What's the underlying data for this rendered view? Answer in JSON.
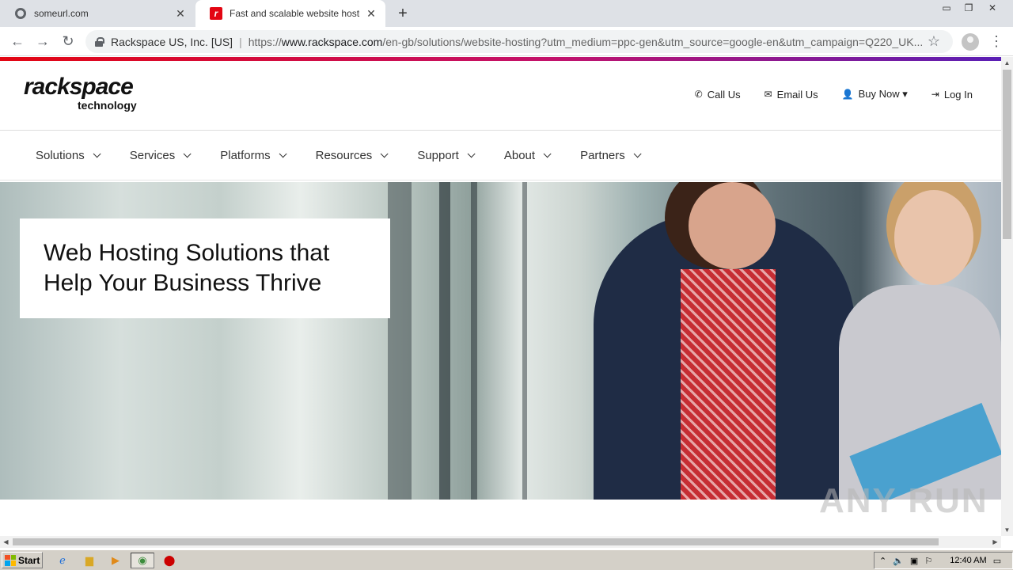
{
  "browser": {
    "tabs": [
      {
        "title": "someurl.com",
        "icon": "globe-icon",
        "active": false
      },
      {
        "title": "Fast and scalable website hosting se",
        "icon": "rackspace-favicon",
        "active": true
      }
    ],
    "omnibox": {
      "site_identity": "Rackspace US, Inc. [US]",
      "url_scheme": "https://",
      "url_host": "www.rackspace.com",
      "url_path": "/en-gb/solutions/website-hosting?utm_medium=ppc-gen&utm_source=google-en&utm_campaign=Q220_UK..."
    },
    "icons": {
      "back": "←",
      "forward": "→",
      "reload": "↻",
      "star": "☆",
      "menu": "⋮",
      "newtab": "+",
      "close": "✕"
    }
  },
  "header": {
    "logo_main": "rackspace",
    "logo_sub": "technology",
    "util_links": [
      {
        "label": "Call Us",
        "icon": "phone-icon",
        "glyph": "✆"
      },
      {
        "label": "Email Us",
        "icon": "envelope-icon",
        "glyph": "✉"
      },
      {
        "label": "Buy Now ▾",
        "icon": "user-plus-icon",
        "glyph": "👤"
      },
      {
        "label": "Log In",
        "icon": "sign-in-icon",
        "glyph": "⇥"
      }
    ]
  },
  "nav": {
    "items": [
      "Solutions",
      "Services",
      "Platforms",
      "Resources",
      "Support",
      "About",
      "Partners"
    ]
  },
  "hero": {
    "title_line1": "Web Hosting Solutions that",
    "title_line2": "Help Your Business Thrive"
  },
  "watermark": "ANY RUN",
  "taskbar": {
    "start_label": "Start",
    "clock": "12:40 AM"
  }
}
